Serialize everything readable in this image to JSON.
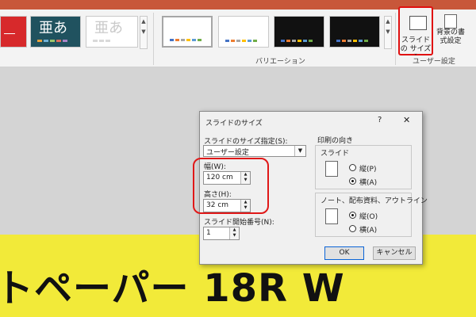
{
  "ribbon": {
    "themes": [
      {
        "text": "",
        "bg": "#d7292b",
        "color": "#ffffff"
      },
      {
        "text": "亜あ",
        "bg": "#20525f",
        "color": "#ffffff"
      },
      {
        "text": "亜あ",
        "bg": "#ffffff",
        "color": "#c9c9c9"
      }
    ],
    "variations_label": "バリエーション",
    "user_settings_label": "ユーザー設定",
    "slide_size_label": "スライドの サイズ ˇ",
    "bg_format_label": "背景の書 式設定"
  },
  "dialog": {
    "title": "スライドのサイズ",
    "help": "?",
    "close": "✕",
    "size_spec_label": "スライドのサイズ指定(S):",
    "size_spec_value": "ユーザー設定",
    "width_label": "幅(W):",
    "width_value": "120 cm",
    "height_label": "高さ(H):",
    "height_value": "32 cm",
    "start_number_label": "スライド開始番号(N):",
    "start_number_value": "1",
    "orientation_label": "印刷の向き",
    "slides_group_label": "スライド",
    "slides_portrait": "縦(P)",
    "slides_landscape": "横(A)",
    "notes_group_label": "ノート、配布資料、アウトライン",
    "notes_portrait": "縦(O)",
    "notes_landscape": "横(A)",
    "ok": "OK",
    "cancel": "キャンセル"
  },
  "slide": {
    "text": "トペーパー 18R W"
  }
}
